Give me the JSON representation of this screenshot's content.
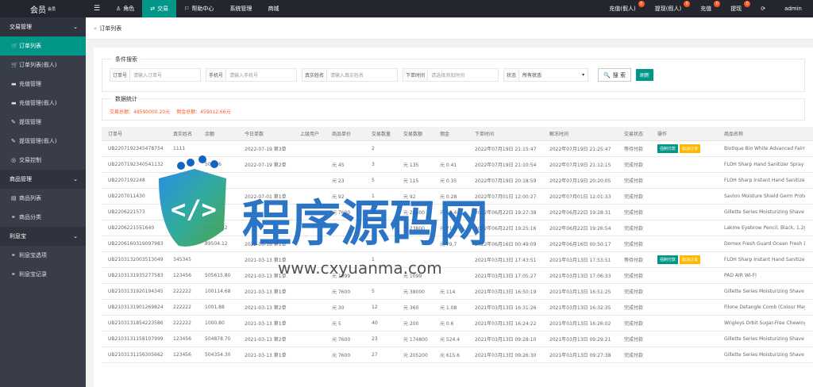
{
  "topbar": {
    "logo": "会员",
    "logo_sup": "会员",
    "menu_icon": "menu-icon",
    "nav": [
      {
        "label": "角色",
        "icon": "user-icon",
        "active": false
      },
      {
        "label": "交易",
        "icon": "trade-icon",
        "active": true
      },
      {
        "label": "帮助中心",
        "icon": "flag-icon",
        "active": false
      },
      {
        "label": "系统管理",
        "icon": "",
        "active": false
      },
      {
        "label": "商城",
        "icon": "",
        "active": false
      }
    ],
    "right": [
      {
        "label": "充值(假人)",
        "badge": "0"
      },
      {
        "label": "提现(假人)",
        "badge": "0"
      },
      {
        "label": "充值",
        "badge": "0"
      },
      {
        "label": "提现",
        "badge": "0"
      },
      {
        "label": "⟳",
        "badge": ""
      },
      {
        "label": "admin",
        "badge": ""
      }
    ]
  },
  "sidebar": {
    "groups": [
      {
        "title": "交易管理",
        "items": [
          {
            "label": "订单列表",
            "icon": "cart-icon",
            "active": true
          },
          {
            "label": "订单列表(假人)",
            "icon": "cart-icon",
            "active": false
          },
          {
            "label": "充值管理",
            "icon": "chat-icon",
            "active": false
          },
          {
            "label": "充值管理(假人)",
            "icon": "chat-icon",
            "active": false
          },
          {
            "label": "提现管理",
            "icon": "hammer-icon",
            "active": false
          },
          {
            "label": "提现管理(假人)",
            "icon": "hammer-icon",
            "active": false
          },
          {
            "label": "交易控制",
            "icon": "control-icon",
            "active": false
          }
        ]
      },
      {
        "title": "商品管理",
        "items": [
          {
            "label": "商品列表",
            "icon": "list-icon",
            "active": false
          },
          {
            "label": "商品分类",
            "icon": "link-icon",
            "active": false
          }
        ]
      },
      {
        "title": "利息宝",
        "items": [
          {
            "label": "利息宝选项",
            "icon": "link-icon",
            "active": false
          },
          {
            "label": "利息宝记录",
            "icon": "link-icon",
            "active": false
          }
        ]
      }
    ]
  },
  "breadcrumb": "订单列表",
  "search": {
    "legend": "条件搜索",
    "order_label": "订单号",
    "order_placeholder": "请输入订单号",
    "phone_label": "手机号",
    "phone_placeholder": "请输入手机号",
    "name_label": "真实姓名",
    "name_placeholder": "请输入真实姓名",
    "time_label": "下单时间",
    "time_placeholder": "请选择添加时间",
    "status_label": "状态",
    "status_value": "所有状态",
    "search_btn": "搜 索",
    "refresh_btn": "刷新"
  },
  "stats": {
    "legend": "数据统计",
    "total_trade": "交易总额：48590000.20元",
    "total_commission": "佣金总额：459012.66元"
  },
  "table": {
    "headers": [
      "订单号",
      "真实姓名",
      "余额",
      "今日单数",
      "上级用户",
      "商品单价",
      "交易数量",
      "交易数额",
      "佣金",
      "下单时间",
      "解冻时间",
      "交易状态",
      "操作",
      "商品名称"
    ],
    "rows": [
      [
        "UB2207192345478754",
        "1111",
        "",
        "2022-07-19 第3单",
        "",
        "",
        "2",
        "",
        "",
        "2022年07月19日 21:15:47",
        "2022年07月19日 21:25:47",
        "等待付款",
        "force",
        "Biotique Bio White Advanced Fairne"
      ],
      [
        "UB2207192340541132",
        "",
        "501.86",
        "2022-07-19 第2单",
        "",
        "元 45",
        "3",
        "元 135",
        "元 0.41",
        "2022年07月19日 21:10:54",
        "2022年07月19日 21:12:15",
        "完成付款",
        "",
        "FLOH Sharp Hand Sanitizer Spray"
      ],
      [
        "UB2207192248",
        "",
        "",
        "",
        "",
        "元 23",
        "5",
        "元 115",
        "元 0.35",
        "2022年07月19日 20:18:59",
        "2022年07月19日 20:20:05",
        "完成付款",
        "",
        "FLOH Sharp Instant Hand Sanitizer"
      ],
      [
        "UB2207011430",
        "",
        "",
        "2022-07-01 第1单",
        "",
        "元 92",
        "1",
        "元 92",
        "元 0.28",
        "2022年07月01日 12:00:27",
        "2022年07月01日 12:01:33",
        "完成付款",
        "",
        "Savlon Moisture Shield Germ Prote"
      ],
      [
        "UB2206221573",
        "",
        "",
        "",
        "",
        "元 7600",
        "3",
        "元 22800",
        "元 68.4",
        "2022年06月22日 19:27:38",
        "2022年06月22日 19:28:31",
        "完成付款",
        "",
        "Gillette Series Moisturizing Shave"
      ],
      [
        "UB2206221551640",
        "",
        "89575.52",
        "",
        "",
        "",
        "",
        "元 23800",
        "元 71.4",
        "2022年06月22日 19:25:16",
        "2022年06月22日 19:26:54",
        "完成付款",
        "",
        "Lakme Eyebrow Pencil, Black, 1.2g"
      ],
      [
        "UB2206160319097983",
        "",
        "89504.12",
        "2022-06-16 第1单",
        "",
        "",
        "",
        "",
        "元 79.7",
        "2022年06月16日 00:49:09",
        "2022年06月16日 00:50:17",
        "完成付款",
        "",
        "Domex Fresh Guard Ocean Fresh Di"
      ],
      [
        "UB2103132003513049",
        "345345",
        "",
        "2021-03-13 第1单",
        "",
        "",
        "1",
        "",
        "",
        "2021年03月13日 17:43:51",
        "2021年03月13日 17:53:51",
        "等待付款",
        "force",
        "FLOH Sharp Instant Hand Sanitizer"
      ],
      [
        "UB2103131935277583",
        "123456",
        "505615.80",
        "2021-03-13 第1单",
        "",
        "元 1099",
        "",
        "元 1099",
        "",
        "2021年03月13日 17:05:27",
        "2021年03月13日 17:06:33",
        "完成付款",
        "",
        "PAD AIR WI-FI"
      ],
      [
        "UB2103131920194345",
        "222222",
        "100114.68",
        "2021-03-13 第1单",
        "",
        "元 7600",
        "5",
        "元 38000",
        "元 114",
        "2021年03月13日 16:50:19",
        "2021年03月13日 16:51:25",
        "完成付款",
        "",
        "Gillette Series Moisturizing Shave"
      ],
      [
        "UB2103131901269824",
        "222222",
        "1001.88",
        "2021-03-13 第2单",
        "",
        "元 30",
        "12",
        "元 360",
        "元 1.08",
        "2021年03月13日 16:31:26",
        "2021年03月13日 16:32:35",
        "完成付款",
        "",
        "Filone Detangle Comb (Colour May"
      ],
      [
        "UB2103131854223586",
        "222222",
        "1000.80",
        "2021-03-13 第1单",
        "",
        "元 5",
        "40",
        "元 200",
        "元 0.6",
        "2021年03月13日 16:24:22",
        "2021年03月13日 16:26:02",
        "完成付款",
        "",
        "Wrigleys Orbit Sugar-Free Chewing"
      ],
      [
        "UB2103131158107999",
        "123456",
        "504878.70",
        "2021-03-13 第2单",
        "",
        "元 7600",
        "23",
        "元 174800",
        "元 524.4",
        "2021年03月13日 09:28:10",
        "2021年03月13日 09:29:21",
        "完成付款",
        "",
        "Gillette Series Moisturizing Shave"
      ],
      [
        "UB2103131156305662",
        "123456",
        "504354.30",
        "2021-03-13 第1单",
        "",
        "元 7600",
        "27",
        "元 205200",
        "元 615.6",
        "2021年03月13日 09:26:30",
        "2021年03月13日 09:27:38",
        "完成付款",
        "",
        "Gillette Series Moisturizing Shave"
      ]
    ],
    "force_btn": "强制付款",
    "cancel_btn": "取消订单"
  },
  "watermark": {
    "title": "程序源码网",
    "url": "www.cxyuanma.com"
  },
  "colors": {
    "accent": "#009688",
    "topbar": "#23262e",
    "sidebar": "#393d49",
    "danger": "#ff5722",
    "warn": "#ffb800"
  }
}
